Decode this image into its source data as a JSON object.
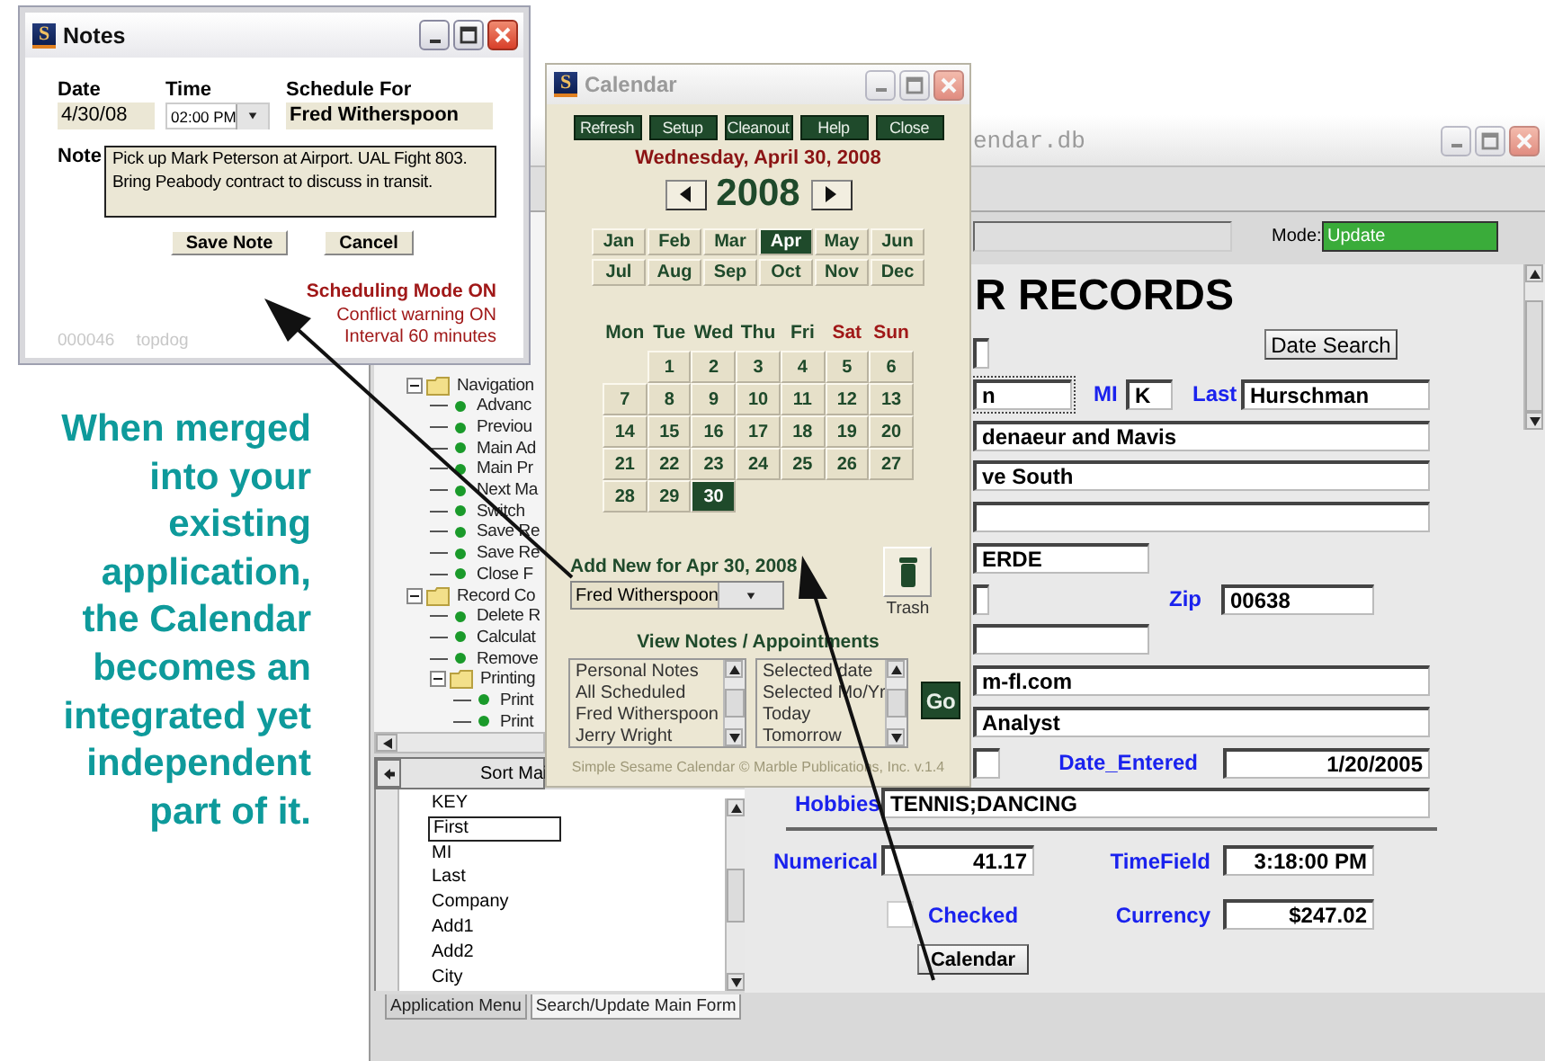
{
  "caption_lines": [
    "When merged",
    "into your",
    "existing",
    "application,",
    "the Calendar",
    "becomes an",
    "integrated yet",
    "independent",
    "part of it."
  ],
  "main_window": {
    "title": "endar.db",
    "active": false,
    "mode_label": "Mode:",
    "mode_value": "Update",
    "tree": [
      {
        "label": "Navigation",
        "expanded": true,
        "children": [
          {
            "label": "Advanc"
          },
          {
            "label": "Previou"
          },
          {
            "label": "Main Ad"
          },
          {
            "label": "Main Pr"
          },
          {
            "label": "Next Ma"
          },
          {
            "label": "Switch"
          },
          {
            "label": "Save Re"
          },
          {
            "label": "Save Re"
          },
          {
            "label": "Close F"
          }
        ]
      },
      {
        "label": "Record Co",
        "expanded": true,
        "children": [
          {
            "label": "Delete R"
          },
          {
            "label": "Calculat"
          },
          {
            "label": "Remove"
          },
          {
            "label": "Printing",
            "expanded": true,
            "children": [
              {
                "label": "Print"
              },
              {
                "label": "Print"
              }
            ]
          }
        ]
      }
    ],
    "sort_header": "Sort Mai",
    "fields": [
      {
        "label": "KEY",
        "selected": false
      },
      {
        "label": "First",
        "selected": true
      },
      {
        "label": "MI",
        "selected": false
      },
      {
        "label": "Last",
        "selected": false
      },
      {
        "label": "Company",
        "selected": false
      },
      {
        "label": "Add1",
        "selected": false
      },
      {
        "label": "Add2",
        "selected": false
      },
      {
        "label": "City",
        "selected": false
      }
    ],
    "tabs": [
      {
        "label": "Application Menu",
        "selected": false
      },
      {
        "label": "Search/Update Main Form",
        "selected": true
      }
    ],
    "form": {
      "heading": "R RECORDS",
      "date_search_button": "Date Search",
      "first": "n",
      "mi_label": "MI",
      "mi": "K",
      "last_label": "Last",
      "last": "Hurschman",
      "company": "denaeur and Mavis",
      "address": "ve South",
      "city": "ERDE",
      "zip_label": "Zip",
      "zip": "00638",
      "email": "m-fl.com",
      "job_title": "Analyst",
      "date_entered_label": "Date_Entered",
      "date_entered": "1/20/2005",
      "hobbies_label": "Hobbies",
      "hobbies": "TENNIS;DANCING",
      "numerical_label": "Numerical",
      "numerical": "41.17",
      "timefield_label": "TimeField",
      "timefield": "3:18:00 PM",
      "checked_label": "Checked",
      "checked": false,
      "currency_label": "Currency",
      "currency": "$247.02",
      "calendar_button": "Calendar"
    }
  },
  "calendar_window": {
    "title": "Calendar",
    "icon_letter": "S",
    "active": false,
    "toolbar": [
      "Refresh",
      "Setup",
      "Cleanout",
      "Help",
      "Close"
    ],
    "date_heading": "Wednesday, April 30, 2008",
    "year": "2008",
    "months": [
      {
        "label": "Jan",
        "selected": false
      },
      {
        "label": "Feb",
        "selected": false
      },
      {
        "label": "Mar",
        "selected": false
      },
      {
        "label": "Apr",
        "selected": true
      },
      {
        "label": "May",
        "selected": false
      },
      {
        "label": "Jun",
        "selected": false
      },
      {
        "label": "Jul",
        "selected": false
      },
      {
        "label": "Aug",
        "selected": false
      },
      {
        "label": "Sep",
        "selected": false
      },
      {
        "label": "Oct",
        "selected": false
      },
      {
        "label": "Nov",
        "selected": false
      },
      {
        "label": "Dec",
        "selected": false
      }
    ],
    "weekdays": [
      {
        "label": "Mon",
        "weekend": false
      },
      {
        "label": "Tue",
        "weekend": false
      },
      {
        "label": "Wed",
        "weekend": false
      },
      {
        "label": "Thu",
        "weekend": false
      },
      {
        "label": "Fri",
        "weekend": false
      },
      {
        "label": "Sat",
        "weekend": true
      },
      {
        "label": "Sun",
        "weekend": true
      }
    ],
    "weeks": [
      [
        {
          "kind": "blank"
        },
        {
          "kind": "day",
          "label": "1",
          "selected": false
        },
        {
          "kind": "day",
          "label": "2",
          "selected": false
        },
        {
          "kind": "day",
          "label": "3",
          "selected": false
        },
        {
          "kind": "day",
          "label": "4",
          "selected": false
        },
        {
          "kind": "day",
          "label": "5",
          "selected": false
        },
        {
          "kind": "day",
          "label": "6",
          "selected": false
        }
      ],
      [
        {
          "kind": "day",
          "label": "7",
          "selected": false
        },
        {
          "kind": "day",
          "label": "8",
          "selected": false
        },
        {
          "kind": "day",
          "label": "9",
          "selected": false
        },
        {
          "kind": "day",
          "label": "10",
          "selected": false
        },
        {
          "kind": "day",
          "label": "11",
          "selected": false
        },
        {
          "kind": "day",
          "label": "12",
          "selected": false
        },
        {
          "kind": "day",
          "label": "13",
          "selected": false
        }
      ],
      [
        {
          "kind": "day",
          "label": "14",
          "selected": false
        },
        {
          "kind": "day",
          "label": "15",
          "selected": false
        },
        {
          "kind": "day",
          "label": "16",
          "selected": false
        },
        {
          "kind": "day",
          "label": "17",
          "selected": false
        },
        {
          "kind": "day",
          "label": "18",
          "selected": false
        },
        {
          "kind": "day",
          "label": "19",
          "selected": false
        },
        {
          "kind": "day",
          "label": "20",
          "selected": false
        }
      ],
      [
        {
          "kind": "day",
          "label": "21",
          "selected": false
        },
        {
          "kind": "day",
          "label": "22",
          "selected": false
        },
        {
          "kind": "day",
          "label": "23",
          "selected": false
        },
        {
          "kind": "day",
          "label": "24",
          "selected": false
        },
        {
          "kind": "day",
          "label": "25",
          "selected": false
        },
        {
          "kind": "day",
          "label": "26",
          "selected": false
        },
        {
          "kind": "day",
          "label": "27",
          "selected": false
        }
      ],
      [
        {
          "kind": "day",
          "label": "28",
          "selected": false
        },
        {
          "kind": "day",
          "label": "29",
          "selected": false
        },
        {
          "kind": "day",
          "label": "30",
          "selected": true
        }
      ]
    ],
    "add_new_label": "Add New for Apr 30, 2008",
    "add_new_person": "Fred Witherspoon",
    "trash_label": "Trash",
    "view_label": "View Notes / Appointments",
    "people_list": [
      "Personal Notes",
      "All Scheduled",
      "Fred Witherspoon",
      "Jerry Wright"
    ],
    "range_list": [
      "Selected date",
      "Selected Mo/Yr",
      "Today",
      "Tomorrow"
    ],
    "go_button": "Go",
    "footer": "Simple Sesame Calendar © Marble Publications, Inc. v.1.4"
  },
  "notes_window": {
    "title": "Notes",
    "icon_letter": "S",
    "active": true,
    "date_label": "Date",
    "time_label": "Time",
    "schedule_label": "Schedule For",
    "date": "4/30/08",
    "time": "02:00 PM",
    "schedule_for": "Fred Witherspoon",
    "note_label": "Note",
    "note": "Pick up Mark Peterson at Airport. UAL Fight 803.\nBring Peabody contract to discuss in transit.",
    "save_button": "Save Note",
    "cancel_button": "Cancel",
    "scheduling_mode": "Scheduling Mode ON",
    "conflict_warning": "Conflict warning ON",
    "interval": "Interval 60 minutes",
    "record_number": "000046",
    "user": "topdog"
  }
}
